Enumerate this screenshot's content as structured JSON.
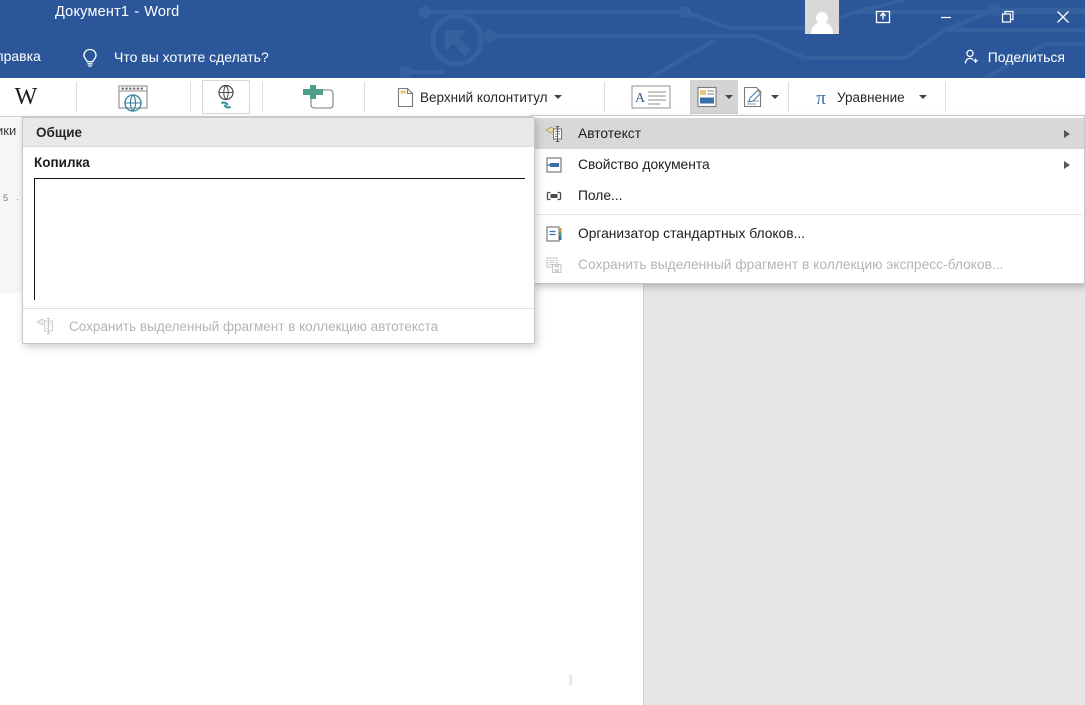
{
  "titlebar": {
    "document_name": "Документ1",
    "separator": "-",
    "app_name": "Word",
    "avatar_name": "user-avatar",
    "buttons": {
      "ribbon_display_options": "Параметры отображения ленты",
      "minimize": "Свернуть",
      "restore": "Развернуть",
      "close": "Закрыть"
    }
  },
  "tellme": {
    "help_tab": "правка",
    "placeholder": "Что вы хотите сделать?",
    "share_label": "Поделиться"
  },
  "ribbon": {
    "items": [
      {
        "name": "wikipedia",
        "label": "",
        "icon": "wikipedia-w-icon"
      },
      {
        "name": "online-video",
        "label": "",
        "icon": "online-video-icon"
      },
      {
        "name": "hyperlink",
        "label": "",
        "icon": "hyperlink-globe-icon"
      },
      {
        "name": "comment",
        "label": "",
        "icon": "new-comment-icon"
      },
      {
        "name": "header",
        "label": "Верхний колонтитул",
        "icon": "header-page-icon"
      },
      {
        "name": "text-box",
        "label": "",
        "icon": "text-box-icon"
      },
      {
        "name": "quick-parts",
        "label": "",
        "icon": "quick-parts-icon"
      },
      {
        "name": "signature-line",
        "label": "",
        "icon": "signature-line-icon"
      },
      {
        "name": "equation",
        "label": "Уравнение",
        "icon": "pi-icon"
      }
    ]
  },
  "ruler": {
    "mark": "5",
    "left_tab_label": "ики"
  },
  "quick_parts_menu": {
    "items": [
      {
        "label": "Автотекст",
        "accel": "А",
        "icon": "autotext-icon",
        "submenu": true,
        "highlighted": true,
        "disabled": false
      },
      {
        "label": "Свойство документа",
        "accel": "й",
        "icon": "document-property-icon",
        "submenu": true,
        "highlighted": false,
        "disabled": false
      },
      {
        "label": "Поле...",
        "accel": "е",
        "icon": "field-icon",
        "submenu": false,
        "highlighted": false,
        "disabled": false
      },
      {
        "label": "Организатор стандартных блоков...",
        "accel": "О",
        "icon": "building-blocks-organizer-icon",
        "submenu": false,
        "highlighted": false,
        "disabled": false
      },
      {
        "label": "Сохранить выделенный фрагмент в коллекцию экспресс-блоков...",
        "accel": "э",
        "icon": "save-selection-icon",
        "submenu": false,
        "highlighted": false,
        "disabled": true
      }
    ]
  },
  "autotext_flyout": {
    "header": "Общие",
    "group_name": "Копилка",
    "footer_label": "Сохранить выделенный фрагмент в коллекцию автотекста",
    "footer_icon": "save-selection-autotext-icon"
  },
  "colors": {
    "title_bar": "#2b579a",
    "ribbon_bg": "#ffffff",
    "workspace_bg": "#e6e6e6",
    "page_bg": "#ffffff",
    "menu_highlight": "#d8d8d8",
    "disabled_text": "#b4b4b4"
  }
}
